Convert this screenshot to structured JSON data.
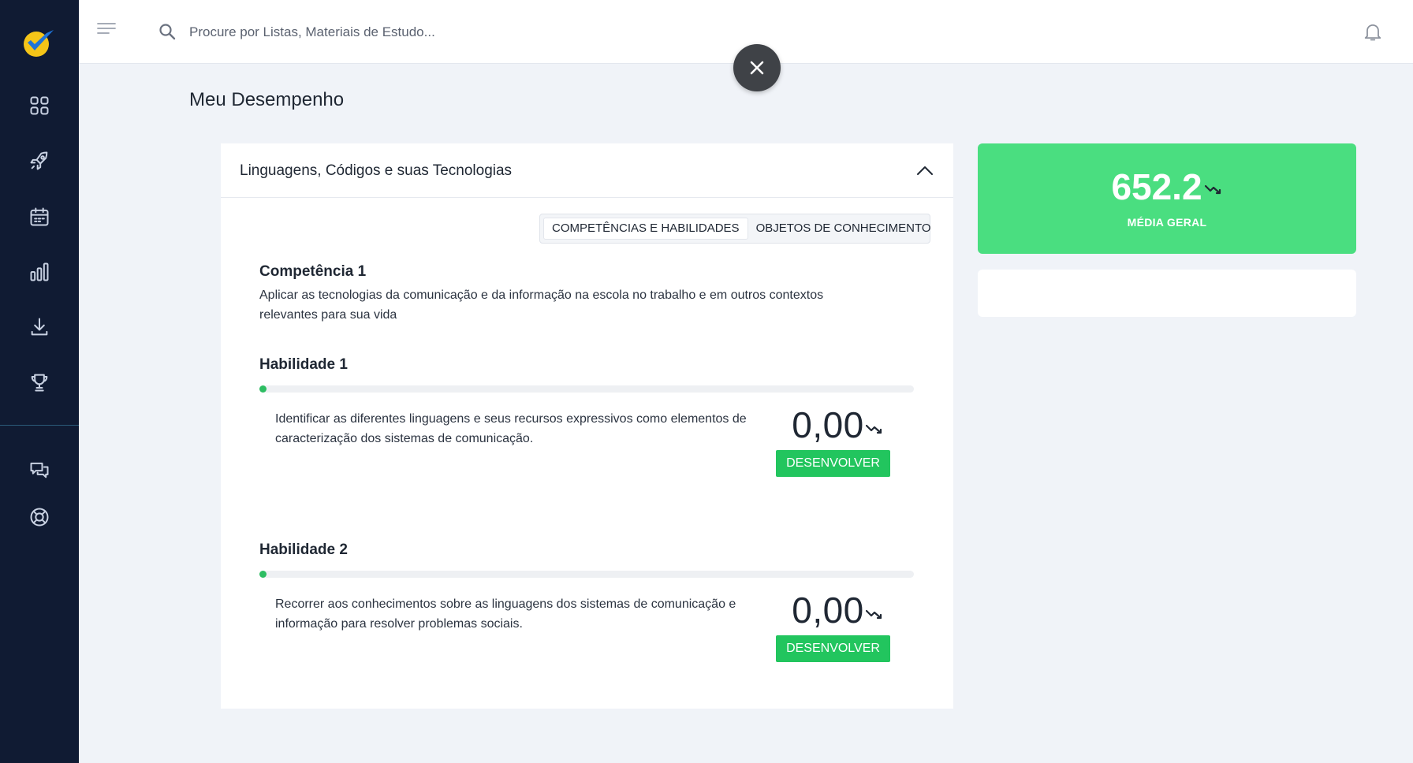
{
  "colors": {
    "sidebar_bg": "#101b33",
    "accent_green": "#22c55e",
    "average_card": "#4ade80",
    "logo_blue": "#1e73d8",
    "logo_yellow": "#f5c518"
  },
  "sidebar": {
    "logo": "check-logo-icon",
    "items": [
      {
        "icon": "dashboard-grid-icon"
      },
      {
        "icon": "rocket-icon"
      },
      {
        "icon": "calendar-icon"
      },
      {
        "icon": "bar-chart-icon"
      },
      {
        "icon": "download-icon"
      },
      {
        "icon": "trophy-icon"
      }
    ],
    "bottom_items": [
      {
        "icon": "chat-bubbles-icon"
      },
      {
        "icon": "lifebuoy-icon"
      }
    ]
  },
  "topbar": {
    "search_placeholder": "Procure por Listas, Materiais de Estudo..."
  },
  "page": {
    "title": "Meu Desempenho"
  },
  "area": {
    "title": "Linguagens, Códigos e suas Tecnologias",
    "tabs": [
      {
        "label": "COMPETÊNCIAS E HABILIDADES",
        "active": true
      },
      {
        "label": "OBJETOS DE CONHECIMENTO",
        "active": false
      }
    ],
    "competence": {
      "title": "Competência 1",
      "description": "Aplicar as tecnologias da comunicação e da informação na escola no trabalho e em outros contextos relevantes para sua vida"
    },
    "skills": [
      {
        "title": "Habilidade 1",
        "progress_fraction": 0.0,
        "description": "Identificar as diferentes linguagens e seus recursos expressivos como elementos de caracterização dos sistemas de comunicação.",
        "score": "0,00",
        "button_label": "DESENVOLVER"
      },
      {
        "title": "Habilidade 2",
        "progress_fraction": 0.0,
        "description": "Recorrer aos conhecimentos sobre as linguagens dos sistemas de comunicação e informação para resolver problemas sociais.",
        "score": "0,00",
        "button_label": "DESENVOLVER"
      }
    ]
  },
  "summary": {
    "average_value": "652.2",
    "average_label": "MÉDIA GERAL"
  }
}
